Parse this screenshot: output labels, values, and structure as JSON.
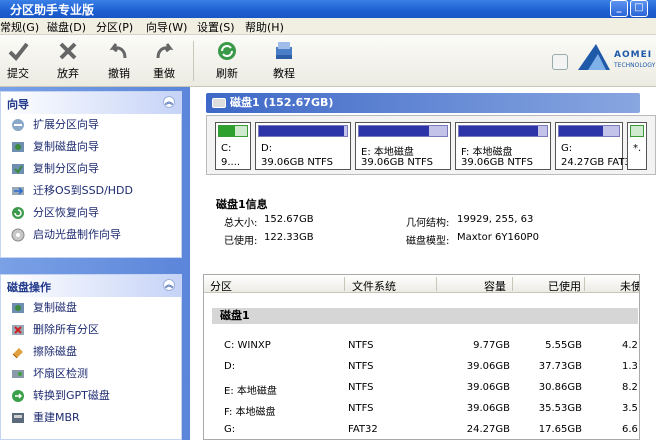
{
  "window": {
    "title": "分区助手专业版",
    "btn_min": "_",
    "btn_max": "□"
  },
  "menu": [
    "常规(G)",
    "磁盘(D)",
    "分区(P)",
    "向导(W)",
    "设置(S)",
    "帮助(H)"
  ],
  "toolbar": {
    "submit": "提交",
    "discard": "放弃",
    "undo": "撤销",
    "redo": "重做",
    "refresh": "刷新",
    "tutorial": "教程"
  },
  "brand": {
    "name": "AOMEI",
    "sub": "TECHNOLOGY"
  },
  "colors": {
    "title_blue": "#1d5fd2",
    "panel_bg": "#6a93df",
    "partition_fill": "#2d34a8",
    "system_partition": "#2ea02e"
  },
  "wizard": {
    "title": "向导",
    "items": [
      "扩展分区向导",
      "复制磁盘向导",
      "复制分区向导",
      "迁移OS到SSD/HDD",
      "分区恢复向导",
      "启动光盘制作向导"
    ]
  },
  "disk_ops": {
    "title": "磁盘操作",
    "items": [
      "复制磁盘",
      "删除所有分区",
      "擦除磁盘",
      "坏扇区检测",
      "转换到GPT磁盘",
      "重建MBR"
    ]
  },
  "disk_header": "磁盘1 (152.67GB)",
  "disk_map": [
    {
      "name": "C:",
      "size": "9....",
      "used_fraction": 0.57,
      "system": true
    },
    {
      "name": "D:",
      "size": "39.06GB NTFS",
      "used_fraction": 0.97,
      "system": false
    },
    {
      "name": "E: 本地磁盘",
      "size": "39.06GB NTFS",
      "used_fraction": 0.79,
      "system": false
    },
    {
      "name": "F: 本地磁盘",
      "size": "39.06GB NTFS",
      "used_fraction": 0.9,
      "system": false
    },
    {
      "name": "G:",
      "size": "24.27GB FAT32",
      "used_fraction": 0.73,
      "system": false
    },
    {
      "name": "*.",
      "size": "",
      "used_fraction": 0.0,
      "system": true
    }
  ],
  "disk_info": {
    "title": "磁盘1信息",
    "total_label": "总大小:",
    "total_value": "152.67GB",
    "used_label": "已使用:",
    "used_value": "122.33GB",
    "geometry_label": "几何结构:",
    "geometry_value": "19929, 255, 63",
    "model_label": "磁盘模型:",
    "model_value": "Maxtor 6Y160P0"
  },
  "table": {
    "headers": [
      "分区",
      "文件系统",
      "容量",
      "已使用",
      "未使"
    ],
    "group": "磁盘1",
    "rows": [
      [
        "C: WINXP",
        "NTFS",
        "9.77GB",
        "5.55GB",
        "4.2"
      ],
      [
        "D:",
        "NTFS",
        "39.06GB",
        "37.73GB",
        "1.3"
      ],
      [
        "E: 本地磁盘",
        "NTFS",
        "39.06GB",
        "30.86GB",
        "8.2"
      ],
      [
        "F: 本地磁盘",
        "NTFS",
        "39.06GB",
        "35.53GB",
        "3.5"
      ],
      [
        "G:",
        "FAT32",
        "24.27GB",
        "17.65GB",
        "6.6"
      ]
    ]
  }
}
